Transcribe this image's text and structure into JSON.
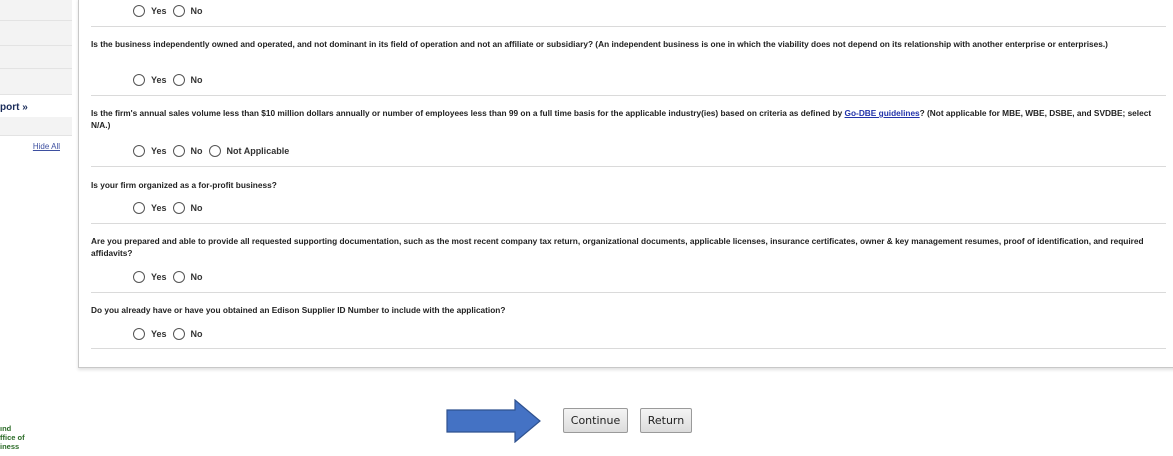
{
  "sidebar": {
    "support_text": "port »",
    "hide_all": "Hide All",
    "footer_lines": [
      "ınd",
      "ffice of",
      "iness"
    ]
  },
  "questions": [
    {
      "text": "",
      "options": [
        "Yes",
        "No"
      ]
    },
    {
      "text": "Is the business independently owned and operated, and not dominant in its field of operation and not an affiliate or subsidiary? (An independent business is one in which the viability does not depend on its relationship with another enterprise or enterprises.)",
      "options": [
        "Yes",
        "No"
      ]
    },
    {
      "text_before_link": "Is the firm's annual sales volume less than $10 million dollars annually or number of employees less than 99 on a full time basis for the applicable industry(ies) based on criteria as defined by ",
      "link": "Go-DBE guidelines",
      "text_after_link": "? (Not applicable for MBE, WBE, DSBE, and SVDBE; select N/A.)",
      "options": [
        "Yes",
        "No",
        "Not Applicable"
      ]
    },
    {
      "text": "Is your firm organized as a for-profit business?",
      "options": [
        "Yes",
        "No"
      ]
    },
    {
      "text": "Are you prepared and able to provide all requested supporting documentation, such as the most recent company tax return, organizational documents, applicable licenses, insurance certificates, owner & key management resumes, proof of identification, and required affidavits?",
      "options": [
        "Yes",
        "No"
      ]
    },
    {
      "text": "Do you already have or have you obtained an Edison Supplier ID Number to include with the application?",
      "options": [
        "Yes",
        "No"
      ]
    }
  ],
  "actions": {
    "continue_label": "Continue",
    "return_label": "Return"
  },
  "colors": {
    "arrow_fill": "#4472c4",
    "arrow_stroke": "#2f528f",
    "link": "#2233aa"
  }
}
